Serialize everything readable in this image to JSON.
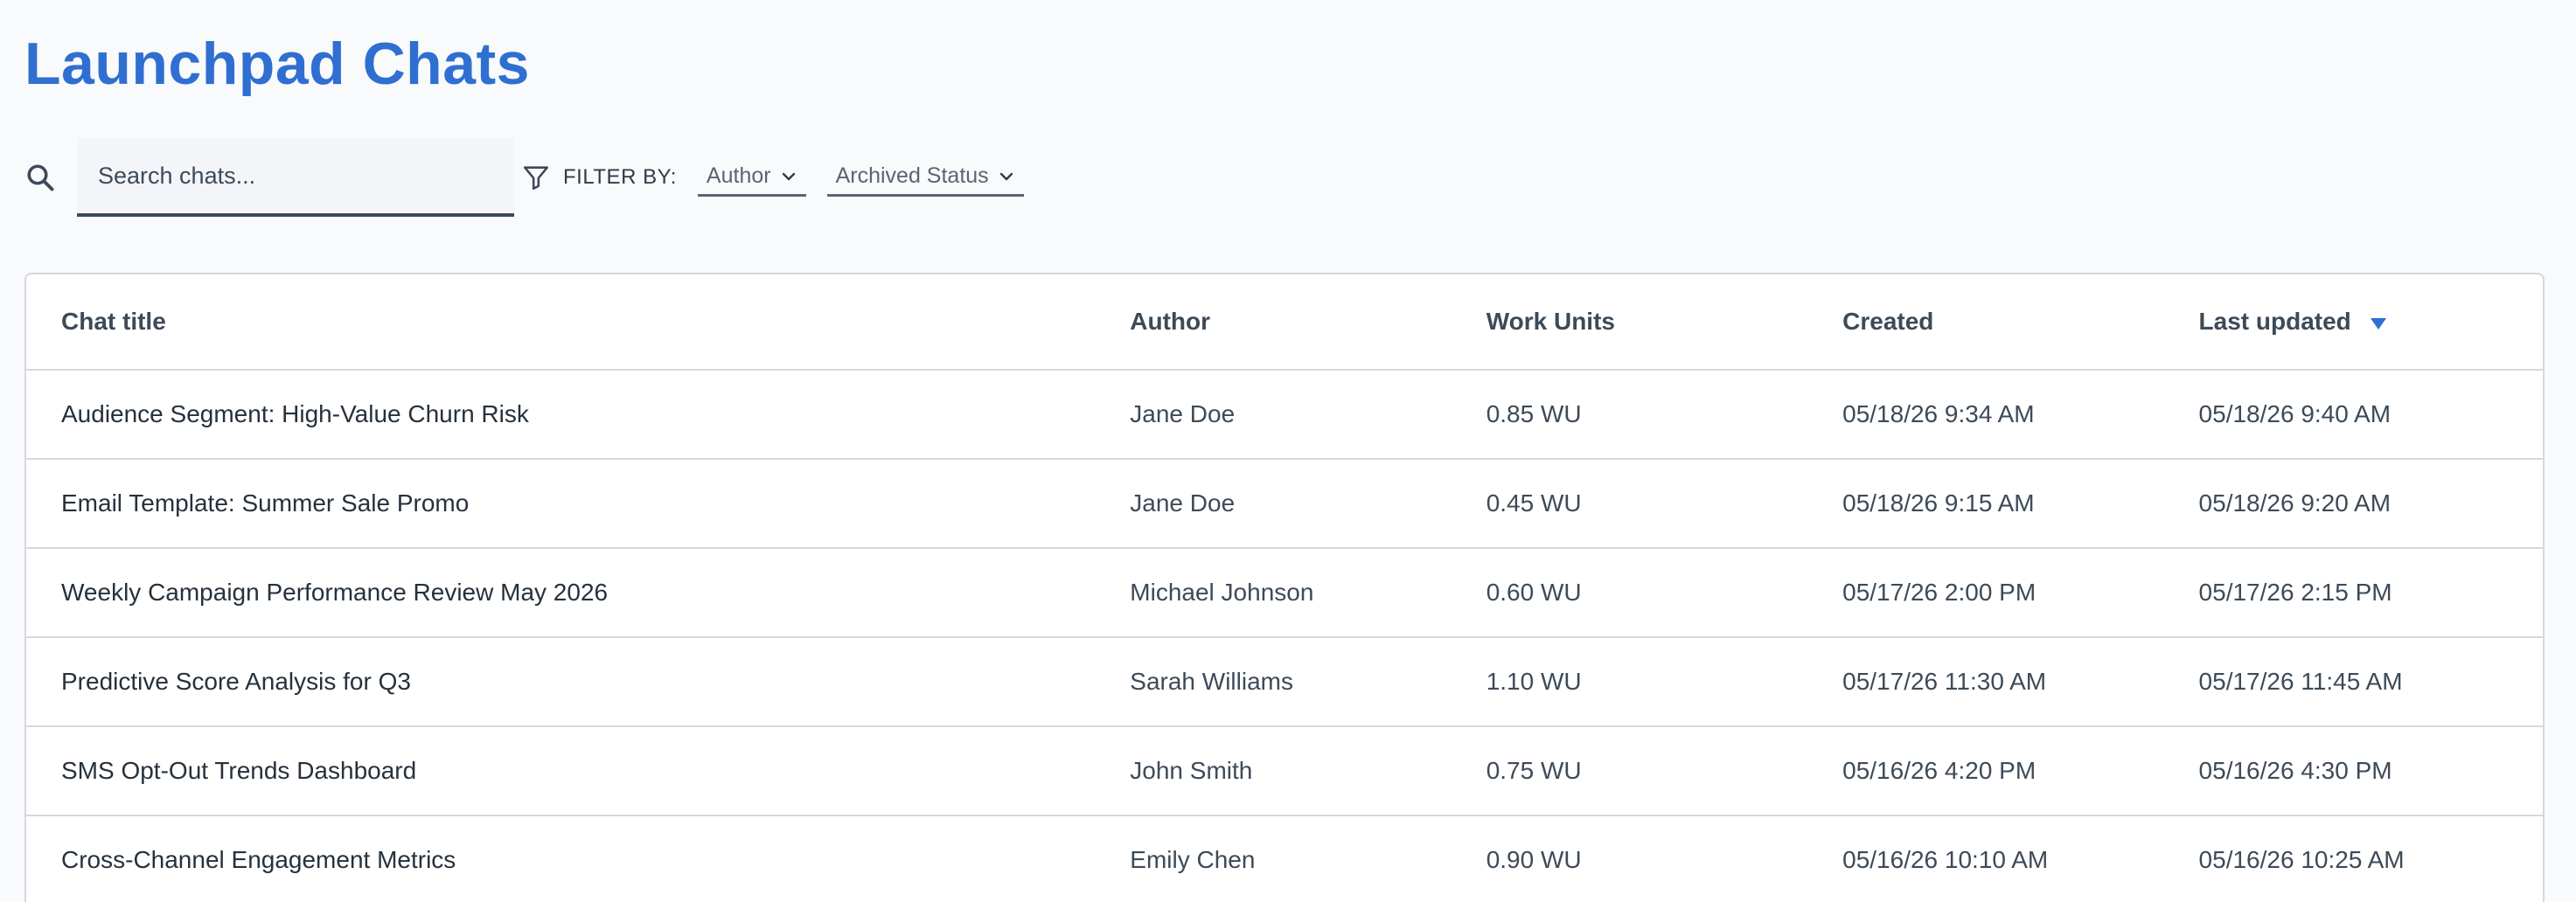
{
  "page": {
    "title": "Launchpad Chats"
  },
  "toolbar": {
    "search_placeholder": "Search chats...",
    "filter_label": "FILTER BY:",
    "filters": [
      {
        "label": "Author"
      },
      {
        "label": "Archived Status"
      }
    ]
  },
  "table": {
    "columns": [
      "Chat title",
      "Author",
      "Work Units",
      "Created",
      "Last updated"
    ],
    "sort_column": "Last updated",
    "sort_direction": "descending",
    "rows": [
      {
        "title": "Audience Segment: High-Value Churn Risk",
        "author": "Jane Doe",
        "work_units": "0.85 WU",
        "created": "05/18/26 9:34 AM",
        "updated": "05/18/26 9:40 AM"
      },
      {
        "title": "Email Template: Summer Sale Promo",
        "author": "Jane Doe",
        "work_units": "0.45 WU",
        "created": "05/18/26 9:15 AM",
        "updated": "05/18/26 9:20 AM"
      },
      {
        "title": "Weekly Campaign Performance Review May 2026",
        "author": "Michael Johnson",
        "work_units": "0.60 WU",
        "created": "05/17/26 2:00 PM",
        "updated": "05/17/26 2:15 PM"
      },
      {
        "title": "Predictive Score Analysis for Q3",
        "author": "Sarah Williams",
        "work_units": "1.10 WU",
        "created": "05/17/26 11:30 AM",
        "updated": "05/17/26 11:45 AM"
      },
      {
        "title": "SMS Opt-Out Trends Dashboard",
        "author": "John Smith",
        "work_units": "0.75 WU",
        "created": "05/16/26 4:20 PM",
        "updated": "05/16/26 4:30 PM"
      },
      {
        "title": "Cross-Channel Engagement Metrics",
        "author": "Emily Chen",
        "work_units": "0.90 WU",
        "created": "05/16/26 10:10 AM",
        "updated": "05/16/26 10:25 AM"
      }
    ]
  },
  "colors": {
    "accent": "#2f6fd1",
    "text": "#3d4a58",
    "border": "#d4d8de",
    "background": "#f9fafc"
  },
  "icons": {
    "search": "search-icon",
    "filter": "filter-icon",
    "dropdown": "chevron-down-icon",
    "sort": "sort-desc-icon"
  }
}
